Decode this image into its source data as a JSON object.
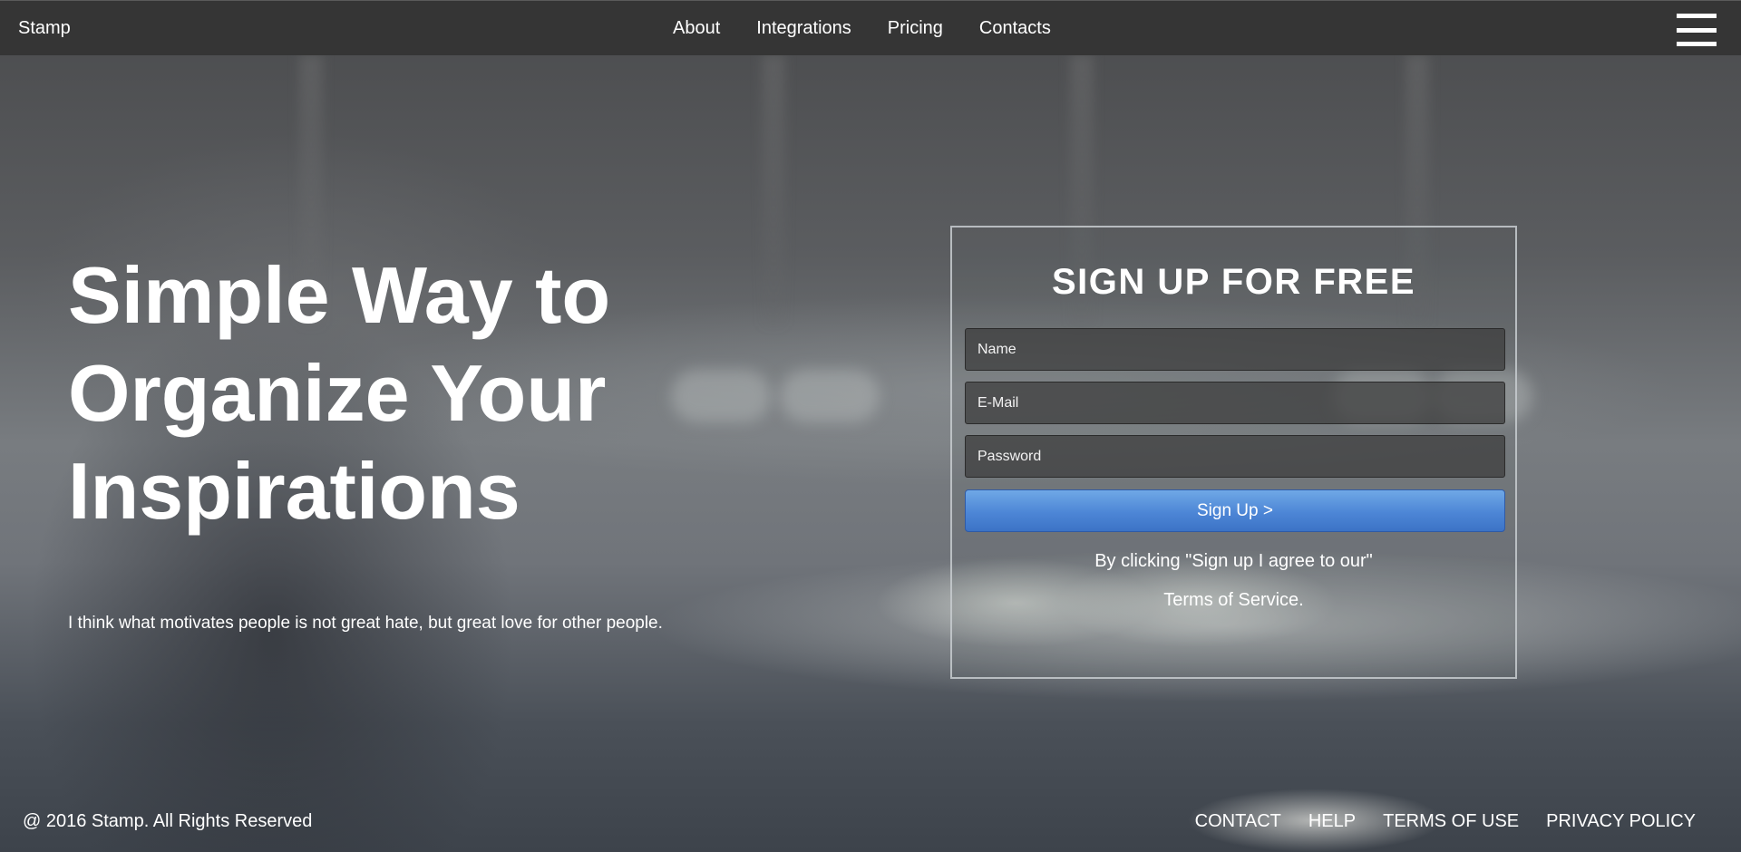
{
  "header": {
    "brand": "Stamp",
    "nav": [
      "About",
      "Integrations",
      "Pricing",
      "Contacts"
    ]
  },
  "hero": {
    "title_lines": [
      "Simple Way to",
      "Organize Your",
      "Inspirations"
    ],
    "quote": "I think what motivates people is not great hate, but great love for other people."
  },
  "signup": {
    "heading": "SIGN UP FOR FREE",
    "name_placeholder": "Name",
    "email_placeholder": "E-Mail",
    "password_placeholder": "Password",
    "button_label": "Sign Up >",
    "terms_line1": "By clicking \"Sign up I agree to our\"",
    "terms_line2": "Terms of Service."
  },
  "footer": {
    "copyright": "@ 2016 Stamp. All Rights Reserved",
    "links": [
      "CONTACT",
      "HELP",
      "TERMS OF USE",
      "PRIVACY POLICY"
    ]
  },
  "colors": {
    "topbar": "#353535",
    "button_blue": "#4d86d6"
  }
}
